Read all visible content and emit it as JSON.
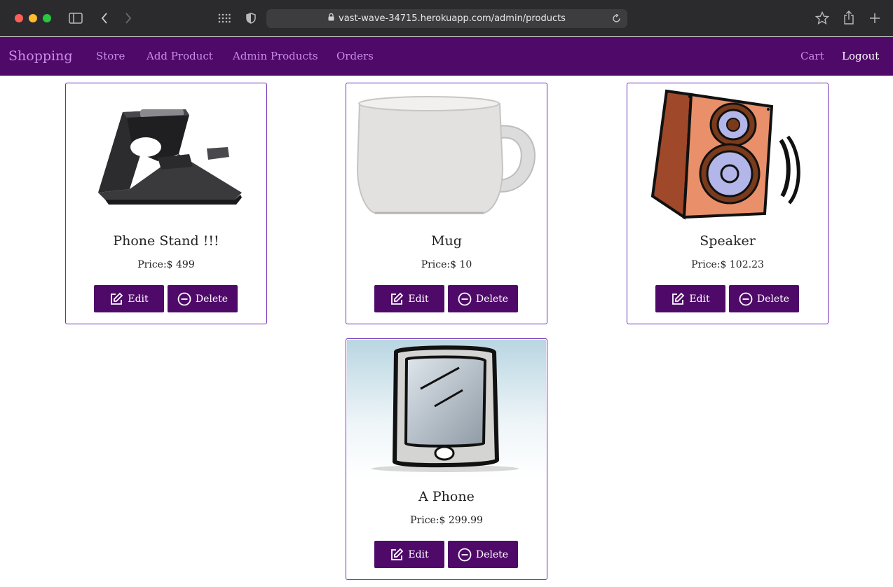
{
  "browser": {
    "url": "vast-wave-34715.herokuapp.com/admin/products"
  },
  "navbar": {
    "brand": "Shopping",
    "links": [
      "Store",
      "Add Product",
      "Admin Products",
      "Orders"
    ],
    "cart": "Cart",
    "logout": "Logout"
  },
  "products": [
    {
      "title": "Phone Stand !!!",
      "price": "Price:$ 499",
      "edit_label": "Edit",
      "delete_label": "Delete"
    },
    {
      "title": "Mug",
      "price": "Price:$ 10",
      "edit_label": "Edit",
      "delete_label": "Delete"
    },
    {
      "title": "Speaker",
      "price": "Price:$ 102.23",
      "edit_label": "Edit",
      "delete_label": "Delete"
    },
    {
      "title": "A Phone",
      "price": "Price:$ 299.99",
      "edit_label": "Edit",
      "delete_label": "Delete"
    }
  ],
  "icons": {
    "edit": "edit-icon",
    "delete": "minus-circle-icon"
  },
  "colors": {
    "navbar": "#4f0a69",
    "nav_link": "#c98be4",
    "button": "#4f0a69",
    "card_border": "#6d2bb5"
  }
}
